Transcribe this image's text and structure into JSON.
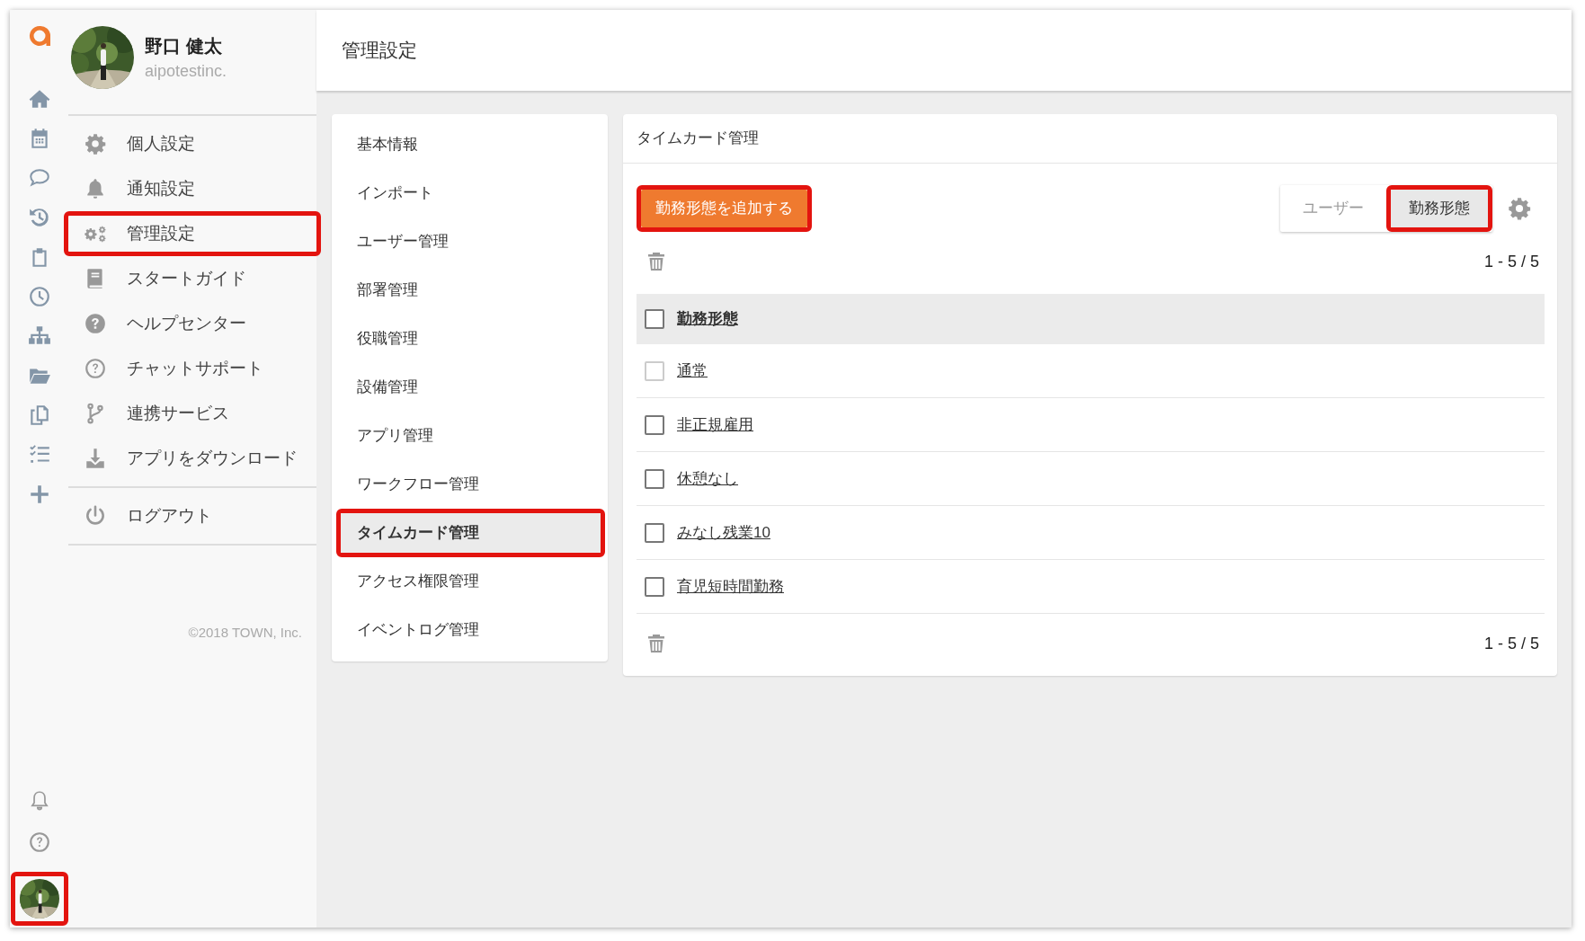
{
  "rail": {
    "avatar_highlighted": true
  },
  "profile": {
    "name": "野口 健太",
    "org": "aipotestinc."
  },
  "menu_sections": [
    {
      "items": [
        {
          "kind": "gear",
          "label": "個人設定",
          "highlighted": false
        },
        {
          "kind": "bell",
          "label": "通知設定",
          "highlighted": false
        },
        {
          "kind": "gears",
          "label": "管理設定",
          "highlighted": true
        },
        {
          "kind": "book",
          "label": "スタートガイド",
          "highlighted": false
        },
        {
          "kind": "help",
          "label": "ヘルプセンター",
          "highlighted": false
        },
        {
          "kind": "help-outline",
          "label": "チャットサポート",
          "highlighted": false
        },
        {
          "kind": "branch",
          "label": "連携サービス",
          "highlighted": false
        },
        {
          "kind": "download",
          "label": "アプリをダウンロード",
          "highlighted": false
        }
      ]
    },
    {
      "items": [
        {
          "kind": "power",
          "label": "ログアウト",
          "highlighted": false
        }
      ]
    }
  ],
  "copyright": "©2018 TOWN, Inc.",
  "header": {
    "title": "管理設定"
  },
  "settings_menu": [
    {
      "label": "基本情報",
      "selected": false,
      "highlighted": false
    },
    {
      "label": "インポート",
      "selected": false,
      "highlighted": false
    },
    {
      "label": "ユーザー管理",
      "selected": false,
      "highlighted": false
    },
    {
      "label": "部署管理",
      "selected": false,
      "highlighted": false
    },
    {
      "label": "役職管理",
      "selected": false,
      "highlighted": false
    },
    {
      "label": "設備管理",
      "selected": false,
      "highlighted": false
    },
    {
      "label": "アプリ管理",
      "selected": false,
      "highlighted": false
    },
    {
      "label": "ワークフロー管理",
      "selected": false,
      "highlighted": false
    },
    {
      "label": "タイムカード管理",
      "selected": true,
      "highlighted": true
    },
    {
      "label": "アクセス権限管理",
      "selected": false,
      "highlighted": false
    },
    {
      "label": "イベントログ管理",
      "selected": false,
      "highlighted": false
    }
  ],
  "panel": {
    "title": "タイムカード管理",
    "add_button": {
      "label": "勤務形態を追加する",
      "highlighted": true
    },
    "toggle": [
      {
        "label": "ユーザー",
        "selected": false,
        "highlighted": false
      },
      {
        "label": "勤務形態",
        "selected": true,
        "highlighted": true
      }
    ],
    "pagination_top": "1 - 5 / 5",
    "table": {
      "header": {
        "label": "勤務形態",
        "checked": false
      },
      "rows": [
        {
          "label": "通常",
          "checked": false,
          "disabled": true
        },
        {
          "label": "非正規雇用",
          "checked": false,
          "disabled": false
        },
        {
          "label": "休憩なし",
          "checked": false,
          "disabled": false
        },
        {
          "label": "みなし残業10",
          "checked": false,
          "disabled": false
        },
        {
          "label": "育児短時間勤務",
          "checked": false,
          "disabled": false
        }
      ]
    },
    "pagination_bottom": "1 - 5 / 5"
  }
}
